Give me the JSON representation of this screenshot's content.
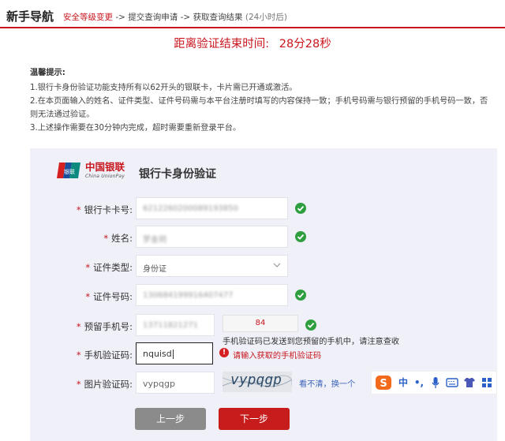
{
  "header": {
    "title": "新手导航",
    "steps": [
      {
        "label": "安全等级变更"
      },
      {
        "label": "->"
      },
      {
        "label": "提交查询申请"
      },
      {
        "label": "->"
      },
      {
        "label": "获取查询结果"
      },
      {
        "label": "(24小时后)"
      }
    ]
  },
  "countdown": {
    "label": "距离验证结束时间:",
    "value": "28分28秒"
  },
  "tips": {
    "title": "温馨提示:",
    "items": [
      "1.银行卡身份验证功能支持所有以62开头的银联卡，卡片需已开通或激活。",
      "2.在本页面输入的姓名、证件类型、证件号码需与本平台注册时填写的内容保持一致；手机号码需与银行预留的手机号码一致，否则无法通过验证。",
      "3.上述操作需要在30分钟内完成，超时需要重新登录平台。"
    ]
  },
  "brand": {
    "logo_cn": "中国银联",
    "logo_en": "China UnionPay",
    "logo_badge_text": "银联",
    "title": "银行卡身份验证"
  },
  "form": {
    "required_mark": "*",
    "fields": {
      "card_no": {
        "label": "银行卡卡号:",
        "value": "6212260200089193850"
      },
      "name": {
        "label": "姓名:",
        "value": "罗金玥"
      },
      "id_type": {
        "label": "证件类型:",
        "value": "身份证"
      },
      "id_no": {
        "label": "证件号码:",
        "value": "130684199916407477"
      },
      "phone": {
        "label": "预留手机号:",
        "value": "13711821271",
        "code_button": "84"
      },
      "sms_code": {
        "label": "手机验证码:",
        "value": "nquisd",
        "error": "请输入获取的手机验证码",
        "error_icon_text": "!"
      },
      "captcha": {
        "label": "图片验证码:",
        "value": "vypqgp",
        "image_text": "vypqgp",
        "refresh": "看不清，换一个"
      }
    },
    "sms_note": "手机验证码已发送到您预留的手机中，请注意查收"
  },
  "ime": {
    "items": [
      {
        "icon": "sogou-s-icon",
        "text": "S"
      },
      {
        "text": "中"
      },
      {
        "text": "•,"
      },
      {
        "icon": "microphone-icon"
      },
      {
        "icon": "keyboard-icon"
      },
      {
        "icon": "shirt-skin-icon"
      },
      {
        "icon": "grid-menu-icon"
      }
    ]
  },
  "buttons": {
    "prev": "上一步",
    "next": "下一步"
  },
  "colors": {
    "brand_red": "#c8161d",
    "success_green": "#2e9e3f",
    "link_blue": "#3a64b8",
    "panel_bg": "#f0f0f8"
  }
}
